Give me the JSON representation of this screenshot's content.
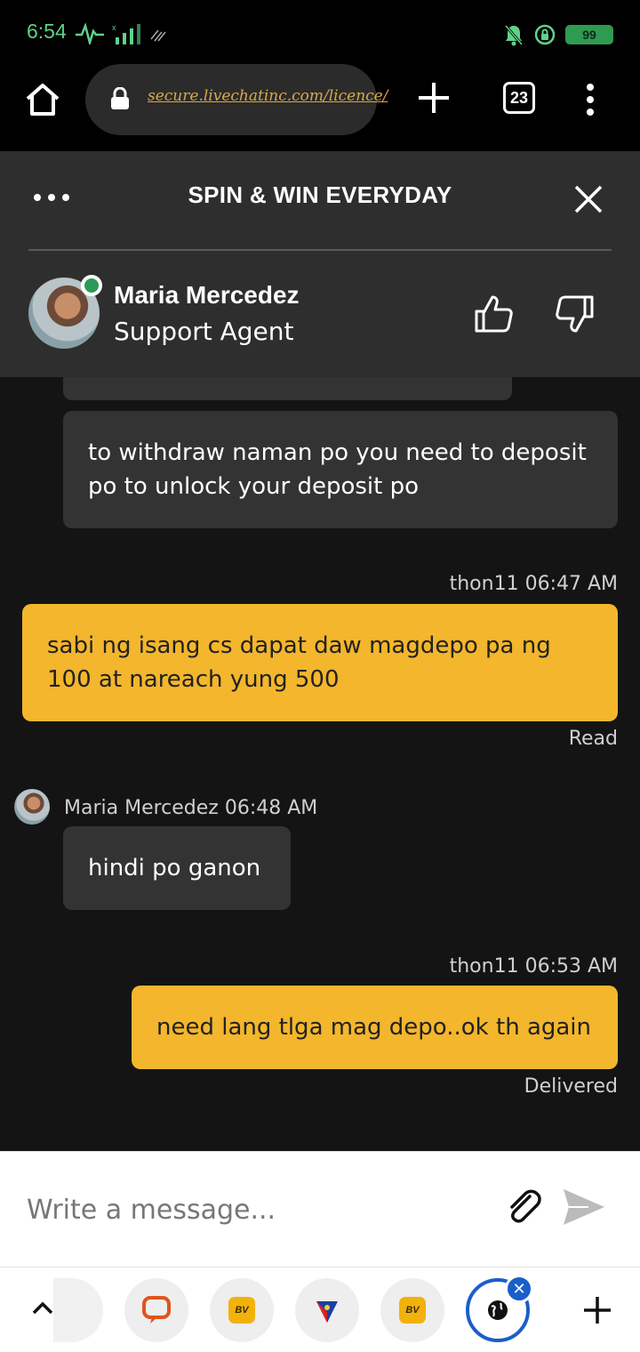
{
  "status_bar": {
    "time": "6:54",
    "battery": "99"
  },
  "browser": {
    "url": "secure.livechatinc.com/licence/",
    "tab_count": "23"
  },
  "chat_header": {
    "title": "SPIN & WIN EVERYDAY",
    "agent_name": "Maria Mercedez",
    "agent_role": "Support Agent"
  },
  "messages": [
    {
      "sender": "agent",
      "text": "to withdraw naman po you need to deposit po to unlock your deposit po"
    },
    {
      "sender": "user",
      "meta": "thon11 06:47 AM",
      "text": "sabi ng isang cs dapat daw magdepo pa ng 100 at nareach yung 500",
      "status": "Read"
    },
    {
      "sender": "agent",
      "meta": "Maria Mercedez 06:48 AM",
      "text": "hindi po ganon"
    },
    {
      "sender": "user",
      "meta": "thon11 06:53 AM",
      "text": "need lang tlga mag depo..ok th again",
      "status": "Delivered"
    }
  ],
  "composer": {
    "placeholder": "Write a message..."
  },
  "bottom_nav": {
    "tabs": [
      "chat-app-icon",
      "bv-icon",
      "flag-icon",
      "bv-icon",
      "globe-icon"
    ],
    "bv_label": "BV"
  },
  "colors": {
    "user_bubble": "#f3b62c",
    "agent_bubble": "#333333",
    "header": "#2e2e2e",
    "accent_blue": "#1a5fc9"
  }
}
